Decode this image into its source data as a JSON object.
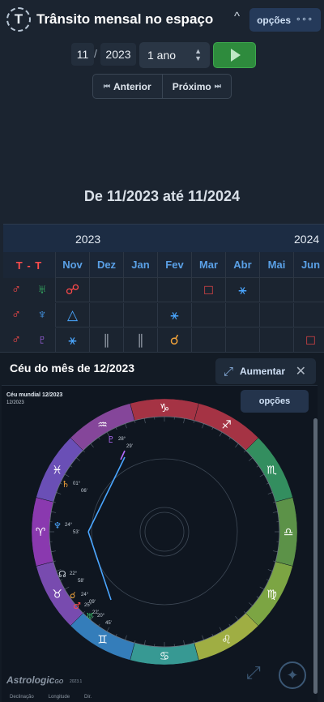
{
  "header": {
    "logo_letter": "T",
    "title": "Trânsito mensal no espaço",
    "caret": "^",
    "options_label": "opções",
    "options_dots": "∘∘∘"
  },
  "controls": {
    "month": "11",
    "separator": "/",
    "year": "2023",
    "period": "1 ano",
    "period_arrows_up": "▲",
    "period_arrows_down": "▼"
  },
  "navigation": {
    "prev_icon": "⏮",
    "prev_label": "Anterior",
    "next_label": "Próximo",
    "next_icon": "⏭"
  },
  "range_title": "De 11/2023 até 11/2024",
  "table": {
    "years": [
      "2023",
      "2024"
    ],
    "label_header": "T - T",
    "months": [
      "Nov",
      "Dez",
      "Jan",
      "Fev",
      "Mar",
      "Abr",
      "Mai",
      "Jun"
    ],
    "rows": [
      {
        "p1": "♂",
        "p1_class": "g-mars",
        "p2": "♅",
        "p2_class": "g-uranus",
        "cells": [
          {
            "g": "☍",
            "c": "asp-red"
          },
          {
            "g": "",
            "c": ""
          },
          {
            "g": "",
            "c": ""
          },
          {
            "g": "",
            "c": ""
          },
          {
            "g": "□",
            "c": "asp-red"
          },
          {
            "g": "⚹",
            "c": "asp-blue"
          },
          {
            "g": "",
            "c": ""
          },
          {
            "g": "",
            "c": ""
          }
        ]
      },
      {
        "p1": "♂",
        "p1_class": "g-mars",
        "p2": "♆",
        "p2_class": "g-neptune",
        "cells": [
          {
            "g": "△",
            "c": "asp-blue"
          },
          {
            "g": "",
            "c": ""
          },
          {
            "g": "",
            "c": ""
          },
          {
            "g": "⚹",
            "c": "asp-blue"
          },
          {
            "g": "",
            "c": ""
          },
          {
            "g": "",
            "c": ""
          },
          {
            "g": "",
            "c": ""
          },
          {
            "g": "",
            "c": ""
          }
        ]
      },
      {
        "p1": "♂",
        "p1_class": "g-mars",
        "p2": "♇",
        "p2_class": "g-pluto",
        "cells": [
          {
            "g": "⚹",
            "c": "asp-blue"
          },
          {
            "g": "∥",
            "c": "asp-gray"
          },
          {
            "g": "∥",
            "c": "asp-gray"
          },
          {
            "g": "☌",
            "c": "asp-orange"
          },
          {
            "g": "",
            "c": ""
          },
          {
            "g": "",
            "c": ""
          },
          {
            "g": "",
            "c": ""
          },
          {
            "g": "□",
            "c": "asp-red"
          }
        ]
      }
    ]
  },
  "panel": {
    "title": "Céu do mês de 12/2023",
    "expand_label": "Aumentar",
    "close": "✕",
    "chart_title": "Céu mundial 12/2023",
    "chart_date": "12/2023",
    "chart_options": "opções",
    "brand": "Astrologic",
    "brand_suffix": "GO",
    "brand_version": "2023.1",
    "column_heads": [
      "Declinação",
      "Longitude",
      "Dir."
    ],
    "zodiac_signs": [
      "♑",
      "♐",
      "♏",
      "♎",
      "♍",
      "♌",
      "♋",
      "♊",
      "♉",
      "♈",
      "♓",
      "♒"
    ],
    "zodiac_colors": [
      "#c0394b",
      "#c0394b",
      "#3aa36a",
      "#6aa84f",
      "#8fbf4a",
      "#b9c94a",
      "#3fb0a8",
      "#3b8fd6",
      "#8b55c9",
      "#a040c9",
      "#7b59d1",
      "#9a4fb0"
    ],
    "planets": [
      {
        "glyph": "♇",
        "deg": "28°",
        "min": "29'"
      },
      {
        "glyph": "♄",
        "deg": "01°",
        "min": "06'"
      },
      {
        "glyph": "♆",
        "deg": "24°",
        "min": "53'"
      },
      {
        "glyph": "☊",
        "deg": "22°",
        "min": "58'"
      },
      {
        "glyph": "☌",
        "deg": "24°",
        "min": "09'"
      },
      {
        "glyph": "♂",
        "deg": "25°",
        "min": "22'"
      },
      {
        "glyph": "♅",
        "deg": "20°",
        "min": "45'"
      }
    ],
    "colors": {
      "accent": "#4aa6ff",
      "wheel_inner": "#0f1620"
    }
  }
}
